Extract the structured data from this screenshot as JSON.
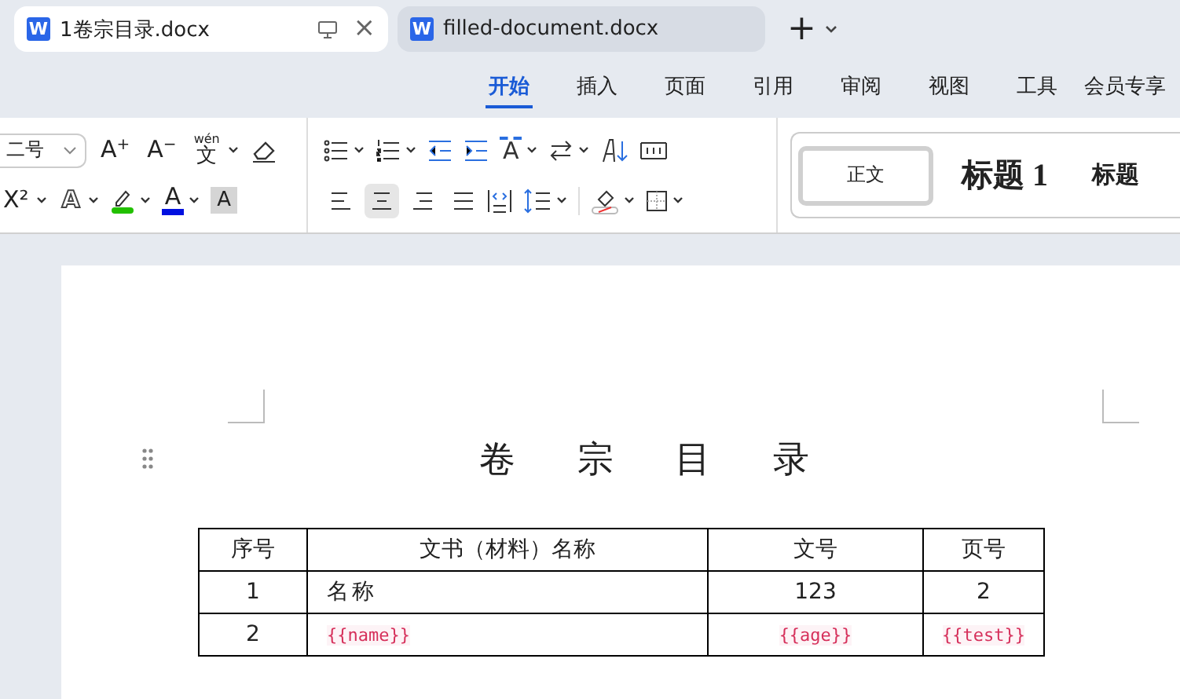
{
  "tabs": [
    {
      "label": "1卷宗目录.docx",
      "selected": true,
      "app_glyph": "W",
      "close": "×"
    },
    {
      "label": "filled-document.docx",
      "selected": false,
      "app_glyph": "W"
    }
  ],
  "new_tab": "+",
  "menu": [
    {
      "label": "开始",
      "selected": true
    },
    {
      "label": "插入",
      "selected": false
    },
    {
      "label": "页面",
      "selected": false
    },
    {
      "label": "引用",
      "selected": false
    },
    {
      "label": "审阅",
      "selected": false
    },
    {
      "label": "视图",
      "selected": false
    },
    {
      "label": "工具",
      "selected": false
    },
    {
      "label": "会员专享",
      "selected": false
    }
  ],
  "ribbon": {
    "font_size": "二号",
    "font_row1": [
      {
        "base": "A",
        "mark": "+"
      },
      {
        "base": "A",
        "mark": "−"
      },
      {
        "base": "文",
        "mark": "wén"
      }
    ],
    "font_row2": [
      {
        "base": "X",
        "mark": "²"
      },
      {
        "base": "A"
      },
      {
        "base": "A"
      },
      {
        "base": "A"
      }
    ],
    "direction_letter": "A",
    "alignment": [
      {
        "selected": false
      },
      {
        "selected": true
      },
      {
        "selected": false
      },
      {
        "selected": false
      }
    ],
    "styles": [
      {
        "label": "正文",
        "selected": true
      },
      {
        "label": "标题 1",
        "selected": false
      },
      {
        "label": "标题",
        "selected": false
      }
    ]
  },
  "document": {
    "title": "卷 宗 目 录",
    "table": {
      "columns": [
        "序号",
        "文书（材料）名称",
        "文号",
        "页号"
      ],
      "rows": [
        [
          {
            "text": "1",
            "kind": "plain"
          },
          {
            "text": "名称",
            "kind": "plain"
          },
          {
            "text": "123",
            "kind": "plain"
          },
          {
            "text": "2",
            "kind": "plain"
          }
        ],
        [
          {
            "text": "2",
            "kind": "plain"
          },
          {
            "text": "{{name}}",
            "kind": "placeholder"
          },
          {
            "text": "{{age}}",
            "kind": "placeholder"
          },
          {
            "text": "{{test}}",
            "kind": "placeholder"
          }
        ]
      ]
    }
  }
}
